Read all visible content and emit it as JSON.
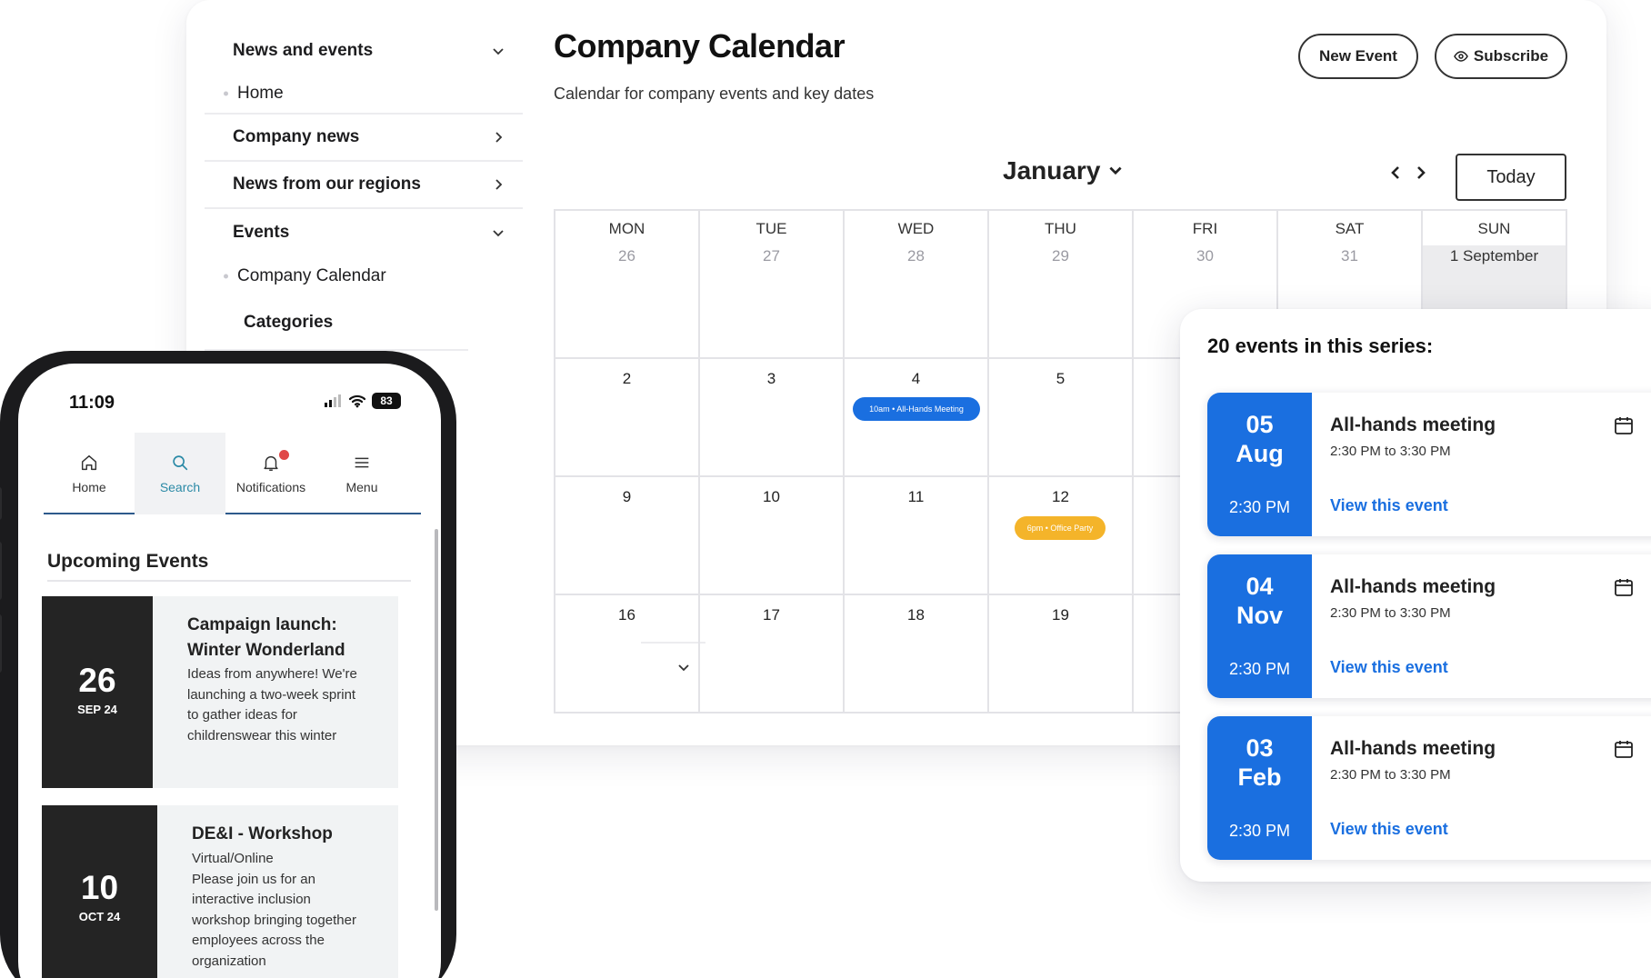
{
  "sidebar": {
    "news_events": "News and events",
    "home": "Home",
    "company_news": "Company news",
    "regions": "News from our regions",
    "events": "Events",
    "company_calendar": "Company Calendar",
    "categories": "Categories"
  },
  "header": {
    "title": "Company Calendar",
    "subtitle": "Calendar for company events and key dates",
    "new_event": "New Event",
    "subscribe": "Subscribe"
  },
  "calendar": {
    "month": "January",
    "today": "Today",
    "weekdays": [
      "MON",
      "TUE",
      "WED",
      "THU",
      "FRI",
      "SAT",
      "SUN"
    ],
    "rows": [
      [
        "26",
        "27",
        "28",
        "29",
        "30",
        "31",
        "1 September"
      ],
      [
        "2",
        "3",
        "4",
        "5",
        "",
        "",
        ""
      ],
      [
        "9",
        "10",
        "11",
        "12",
        "",
        "",
        ""
      ],
      [
        "16",
        "17",
        "18",
        "19",
        "",
        "",
        ""
      ]
    ],
    "events": {
      "allhands": "10am • All-Hands Meeting",
      "party": "6pm • Office Party"
    }
  },
  "series": {
    "title": "20 events in this series:",
    "items": [
      {
        "day": "05",
        "month": "Aug",
        "time": "2:30 PM",
        "name": "All-hands meeting",
        "range": "2:30 PM to 3:30 PM",
        "link": "View this event"
      },
      {
        "day": "04",
        "month": "Nov",
        "time": "2:30 PM",
        "name": "All-hands meeting",
        "range": "2:30 PM to 3:30 PM",
        "link": "View this event"
      },
      {
        "day": "03",
        "month": "Feb",
        "time": "2:30 PM",
        "name": "All-hands meeting",
        "range": "2:30 PM to 3:30 PM",
        "link": "View this event"
      }
    ]
  },
  "phone": {
    "time": "11:09",
    "battery": "83",
    "tabs": [
      "Home",
      "Search",
      "Notifications",
      "Menu"
    ],
    "upcoming_title": "Upcoming Events",
    "cards": [
      {
        "num": "26",
        "sub": "SEP 24",
        "title": "Campaign launch: Winter Wonderland",
        "desc": "Ideas from anywhere! We're launching a two-week sprint to gather ideas for childrenswear this winter"
      },
      {
        "num": "10",
        "sub": "OCT 24",
        "title": "DE&I - Workshop",
        "desc": "Virtual/Online\nPlease join us for an interactive inclusion workshop bringing together employees across the organization"
      }
    ]
  },
  "colors": {
    "accent": "#1a6fe0",
    "party": "#f4b42a",
    "dark": "#242424",
    "search_active": "#2b8aa6"
  }
}
